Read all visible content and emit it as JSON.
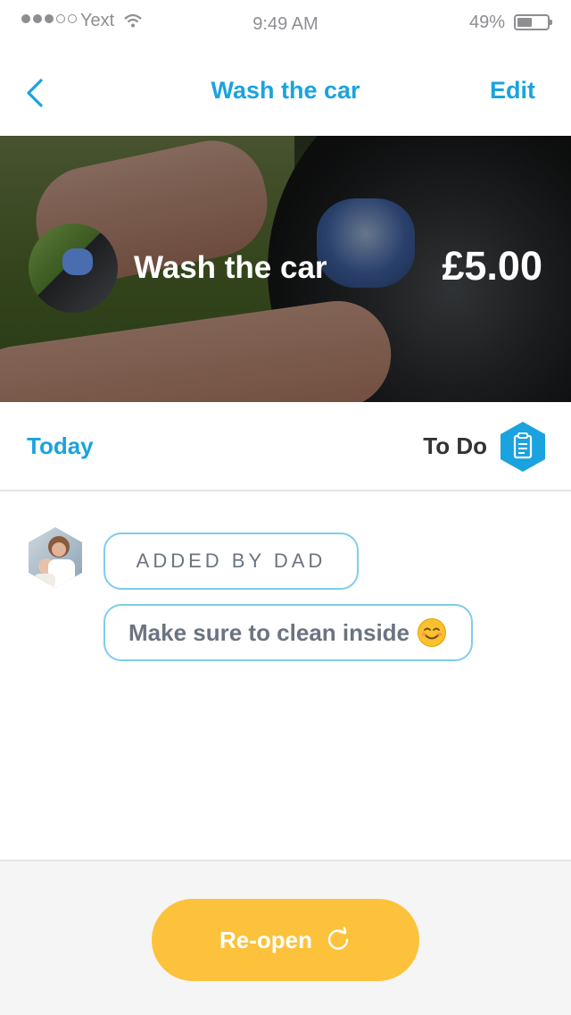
{
  "status_bar": {
    "carrier": "Yext",
    "time": "9:49 AM",
    "battery_percent": "49%",
    "battery_level": 0.49
  },
  "nav": {
    "title": "Wash the car",
    "edit_label": "Edit",
    "back_icon": "chevron-left-icon"
  },
  "hero": {
    "task_name": "Wash the car",
    "price": "£5.00"
  },
  "due": {
    "date_label": "Today",
    "status_label": "To Do",
    "status_icon": "clipboard-icon"
  },
  "comments": {
    "added_by": "ADDED BY DAD",
    "message": "Make sure to clean inside",
    "message_emoji": "smiling-face-emoji"
  },
  "footer": {
    "reopen_label": "Re-open",
    "reopen_icon": "refresh-icon"
  },
  "colors": {
    "accent": "#1aa3de",
    "button": "#fcc23c",
    "bubble_border": "#7fcdeb"
  }
}
